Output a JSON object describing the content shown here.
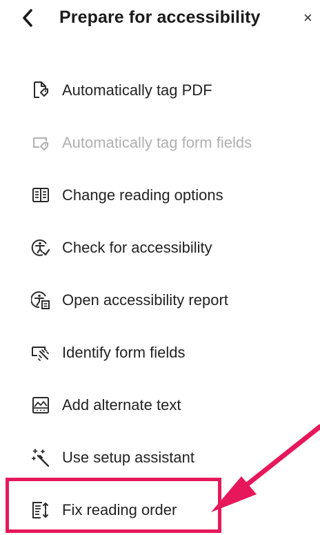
{
  "header": {
    "title": "Prepare for accessibility",
    "close_glyph": "×"
  },
  "menu": {
    "items": [
      {
        "label": "Automatically tag PDF",
        "icon": "tag-pdf-icon",
        "enabled": true
      },
      {
        "label": "Automatically tag form fields",
        "icon": "tag-form-fields-icon",
        "enabled": false
      },
      {
        "label": "Change reading options",
        "icon": "book-icon",
        "enabled": true
      },
      {
        "label": "Check for accessibility",
        "icon": "accessibility-check-icon",
        "enabled": true
      },
      {
        "label": "Open accessibility report",
        "icon": "accessibility-report-icon",
        "enabled": true
      },
      {
        "label": "Identify form fields",
        "icon": "form-fields-icon",
        "enabled": true
      },
      {
        "label": "Add alternate text",
        "icon": "image-alt-text-icon",
        "enabled": true
      },
      {
        "label": "Use setup assistant",
        "icon": "magic-wand-icon",
        "enabled": true
      },
      {
        "label": "Fix reading order",
        "icon": "reading-order-icon",
        "enabled": true
      }
    ]
  },
  "colors": {
    "text": "#222222",
    "disabled_text": "#b0b0b0",
    "highlight": "#e6185b"
  }
}
